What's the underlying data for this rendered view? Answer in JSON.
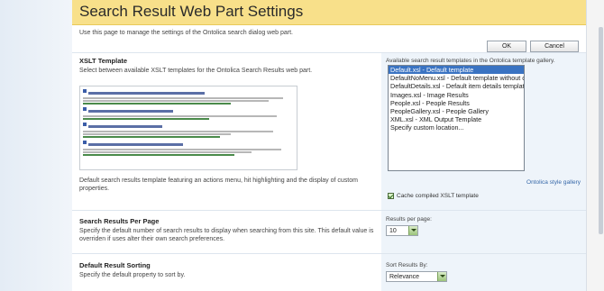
{
  "page": {
    "title": "Search Result Web Part Settings",
    "description": "Use this page to manage the settings of the Ontolica search dialog web part.",
    "ok_label": "OK",
    "cancel_label": "Cancel"
  },
  "xslt": {
    "title": "XSLT Template",
    "text": "Select between available XSLT templates for the Ontolica Search Results web part.",
    "caption": "Default search results template featuring an actions menu, hit highlighting and the display of custom properties.",
    "available_label": "Available search result templates in the Ontolica template gallery.",
    "options": [
      "Default.xsl - Default template",
      "DefaultNoMenu.xsl - Default template without conte",
      "DefaultDetails.xsl - Default item details template",
      "Images.xsl - Image Results",
      "People.xsl - People Results",
      "PeopleGallery.xsl - People Gallery",
      "XML.xsl - XML Output Template",
      "Specify custom location..."
    ],
    "selected_index": 0,
    "gallery_link": "Ontolica style gallery",
    "cache_label": "Cache compiled XSLT template",
    "cache_checked": true
  },
  "per_page": {
    "title": "Search Results Per Page",
    "text": "Specify the default number of search results to display when searching from this site. This default value is overriden if uses alter their own search preferences.",
    "field_label": "Results per page:",
    "value": "10"
  },
  "sorting": {
    "title": "Default Result Sorting",
    "text": "Specify the default property to sort by.",
    "field_label": "Sort Results By:",
    "value": "Relevance"
  },
  "colors": {
    "title_bar": "#f8e08a",
    "selection": "#3a73c2",
    "link": "#3567a8"
  }
}
